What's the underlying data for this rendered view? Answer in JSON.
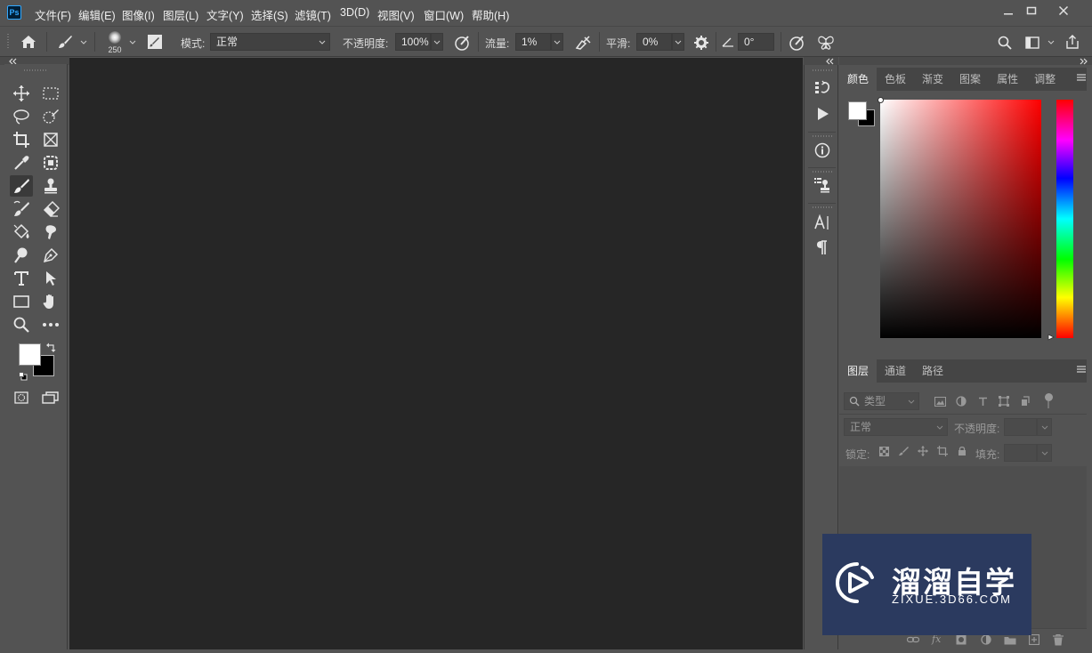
{
  "app": {
    "logo_text": "Ps"
  },
  "menu": [
    "文件(F)",
    "编辑(E)",
    "图像(I)",
    "图层(L)",
    "文字(Y)",
    "选择(S)",
    "滤镜(T)",
    "3D(D)",
    "视图(V)",
    "窗口(W)",
    "帮助(H)"
  ],
  "options_bar": {
    "brush_size": "250",
    "mode_label": "模式:",
    "mode_value": "正常",
    "opacity_label": "不透明度:",
    "opacity_value": "100%",
    "flow_label": "流量:",
    "flow_value": "1%",
    "smoothing_label": "平滑:",
    "smoothing_value": "0%",
    "angle_value": "0°"
  },
  "toolbar": {
    "tools": [
      "move-tool",
      "marquee-tool",
      "lasso-tool",
      "quick-selection-tool",
      "crop-tool",
      "frame-tool",
      "eyedropper-tool",
      "patch-tool",
      "brush-tool",
      "clone-stamp-tool",
      "history-brush-tool",
      "eraser-tool",
      "paint-bucket-tool",
      "blur-tool",
      "dodge-tool",
      "pen-tool",
      "type-tool",
      "path-selection-tool",
      "rectangle-tool",
      "hand-tool",
      "zoom-tool",
      "more-tools"
    ],
    "active_tool": "brush-tool",
    "foreground_color": "#ffffff",
    "background_color": "#000000"
  },
  "color_panel": {
    "tabs": [
      "颜色",
      "色板",
      "渐变",
      "图案",
      "属性",
      "调整"
    ],
    "active_tab": "颜色"
  },
  "layers_panel": {
    "tabs": [
      "图层",
      "通道",
      "路径"
    ],
    "active_tab": "图层",
    "filter_label": "类型",
    "blend_mode": "正常",
    "opacity_label": "不透明度:",
    "lock_label": "锁定:",
    "fill_label": "填充:"
  },
  "watermark": {
    "title": "溜溜自学",
    "subtitle": "ZIXUE.3D66.COM"
  },
  "colors": {
    "background": "#535353",
    "canvas": "#262626",
    "panel_tab_bar": "#454545",
    "watermark_bg": "#2b3a5f"
  }
}
